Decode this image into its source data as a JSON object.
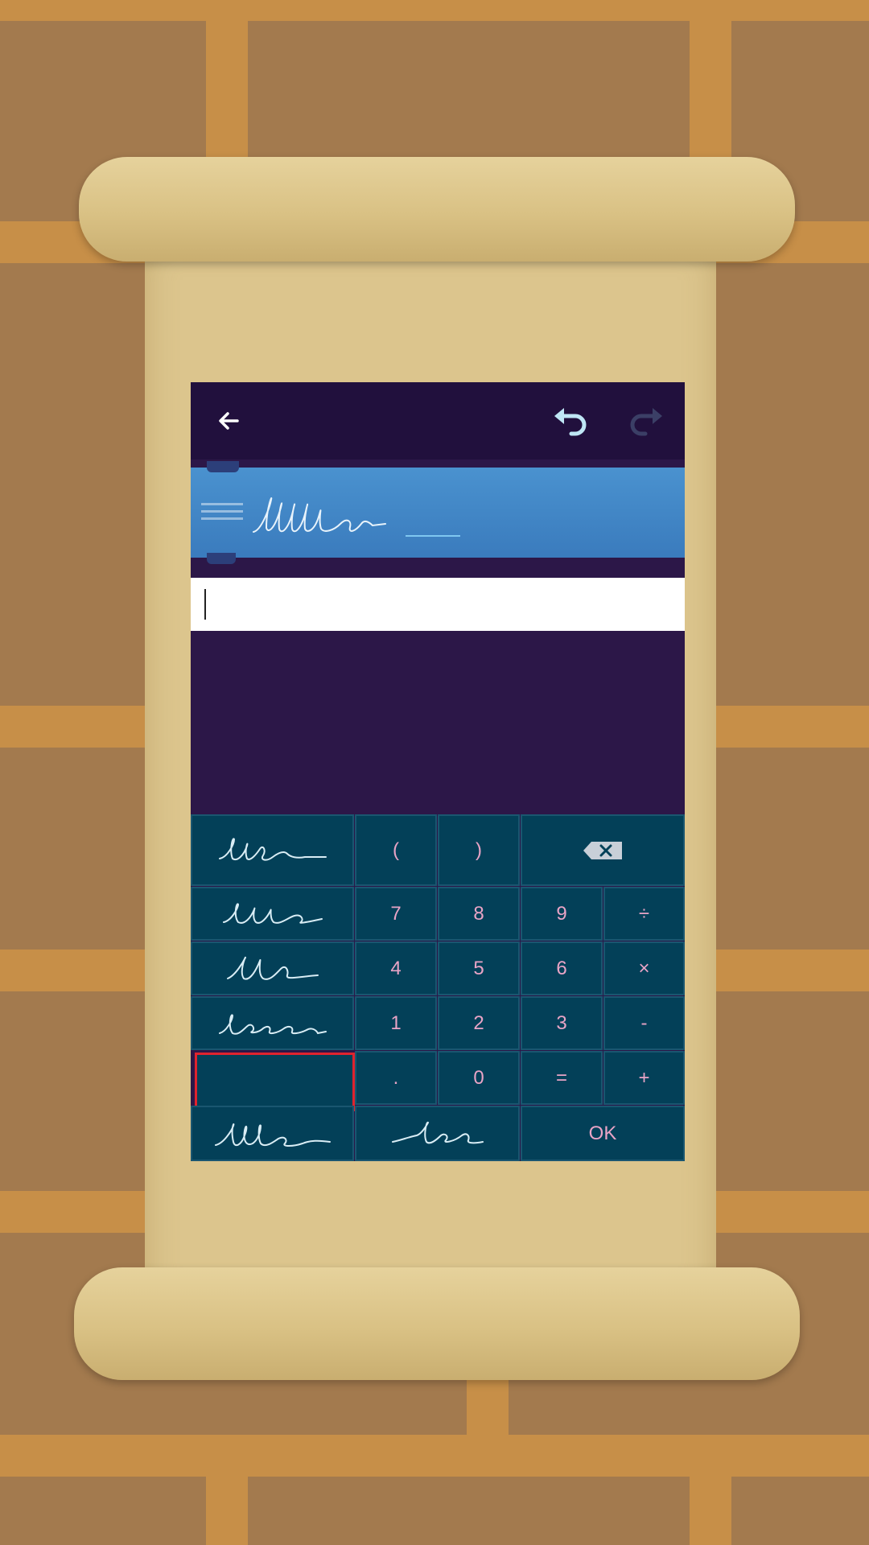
{
  "toolbar": {
    "back_icon": "arrow-left-icon",
    "undo_icon": "undo-icon",
    "redo_icon": "redo-icon"
  },
  "input": {
    "value": "",
    "placeholder": ""
  },
  "keypad": {
    "paren_open": "(",
    "paren_close": ")",
    "backspace_icon": "backspace-icon",
    "seven": "7",
    "eight": "8",
    "nine": "9",
    "divide": "÷",
    "four": "4",
    "five": "5",
    "six": "6",
    "multiply": "×",
    "one": "1",
    "two": "2",
    "three": "3",
    "minus": "-",
    "dot": ".",
    "zero": "0",
    "equals": "=",
    "plus": "+",
    "ok": "OK"
  },
  "colors": {
    "app_background": "#2c1748",
    "topbar": "#21103d",
    "banner": "#3f86c6",
    "key_background": "#034058",
    "key_text": "#e9a4c6",
    "selected_outline": "#e0232e",
    "undo_active": "#bfe6f5",
    "redo_disabled": "#3b3f66"
  }
}
